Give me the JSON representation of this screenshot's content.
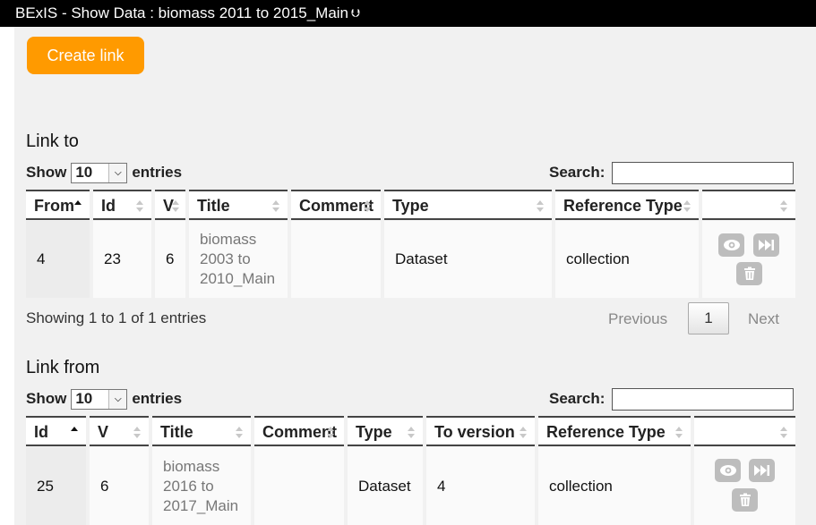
{
  "window": {
    "title": "BExIS - Show Data : biomass 2011 to 2015_Main"
  },
  "toolbar": {
    "create_link_label": "Create link"
  },
  "link_to": {
    "heading": "Link to",
    "show_label": "Show",
    "entries_value": "10",
    "entries_label": "entries",
    "search_label": "Search:",
    "columns": [
      "From",
      "Id",
      "V",
      "Title",
      "Comment",
      "Type",
      "Reference Type",
      ""
    ],
    "rows": [
      {
        "from": "4",
        "id": "23",
        "v": "6",
        "title": "biomass 2003 to 2010_Main",
        "comment": "",
        "type": "Dataset",
        "reference_type": "collection"
      }
    ],
    "info": "Showing 1 to 1 of 1 entries",
    "previous_label": "Previous",
    "page": "1",
    "next_label": "Next"
  },
  "link_from": {
    "heading": "Link from",
    "show_label": "Show",
    "entries_value": "10",
    "entries_label": "entries",
    "search_label": "Search:",
    "columns": [
      "Id",
      "V",
      "Title",
      "Comment",
      "Type",
      "To version",
      "Reference Type",
      ""
    ],
    "rows": [
      {
        "id": "25",
        "v": "6",
        "title": "biomass 2016 to 2017_Main",
        "comment": "",
        "type": "Dataset",
        "to_version": "4",
        "reference_type": "collection"
      }
    ]
  },
  "icons": {
    "view": "eye-icon",
    "next": "fast-forward-icon",
    "delete": "trash-icon"
  },
  "colors": {
    "accent": "#ff9a00",
    "titlebar": "#000000",
    "icon_button": "#bdbdbd"
  }
}
